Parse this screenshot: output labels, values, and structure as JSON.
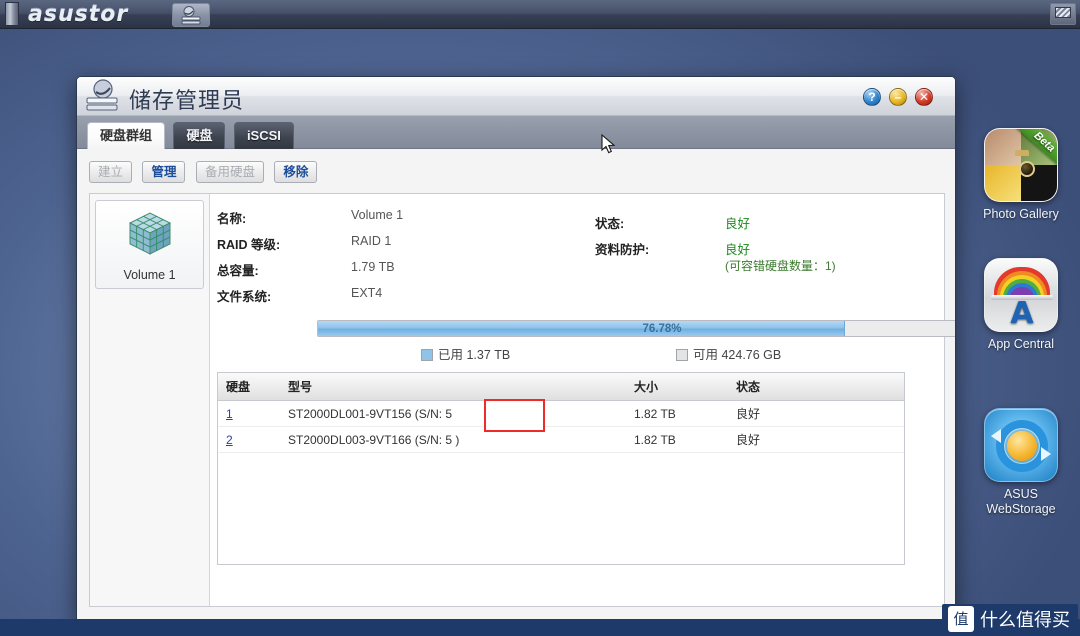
{
  "topbar": {
    "brand": "asustor",
    "storage_tile_icon": "storage-manager-icon",
    "right_icon": "display-icon"
  },
  "desktop": {
    "icons": [
      {
        "label": "Photo Gallery",
        "icon": "photo-gallery-icon",
        "badge": "Beta"
      },
      {
        "label": "App Central",
        "icon": "app-central-icon",
        "badge": ""
      },
      {
        "label": "ASUS WebStorage",
        "label_line1": "ASUS",
        "label_line2": "WebStorage",
        "icon": "asus-webstorage-icon",
        "badge": ""
      }
    ]
  },
  "window": {
    "title": "储存管理员",
    "icon": "storage-manager-icon",
    "controls": {
      "help": "?",
      "minimize": "–",
      "close": "✕"
    },
    "tabs": [
      {
        "label": "硬盘群组",
        "active": true
      },
      {
        "label": "硬盘",
        "active": false
      },
      {
        "label": "iSCSI",
        "active": false
      }
    ],
    "toolbar": [
      {
        "label": "建立",
        "enabled": false
      },
      {
        "label": "管理",
        "enabled": true
      },
      {
        "label": "备用硬盘",
        "enabled": false
      },
      {
        "label": "移除",
        "enabled": true
      }
    ],
    "volume_list": [
      {
        "label": "Volume 1",
        "icon": "volume-cube-icon"
      }
    ],
    "details": {
      "name_label": "名称:",
      "name_value": "Volume 1",
      "raid_label": "RAID 等级:",
      "raid_value": "RAID 1",
      "capacity_label": "总容量:",
      "capacity_value": "1.79 TB",
      "filesystem_label": "文件系统:",
      "filesystem_value": "EXT4",
      "status_label": "状态:",
      "status_value": "良好",
      "protection_label": "资料防护:",
      "protection_value": "良好",
      "protection_note": "(可容错硬盘数量：1)"
    },
    "usage": {
      "percent_label": "76.78%",
      "percent_value": 76.78,
      "used_label": "已用 1.37 TB",
      "free_label": "可用 424.76 GB"
    },
    "disk_table": {
      "headers": [
        "硬盘",
        "型号",
        "大小",
        "状态"
      ],
      "rows": [
        {
          "index": "1",
          "model": "ST2000DL001-9VT156 (S/N: 5",
          "size": "1.82 TB",
          "state": "良好"
        },
        {
          "index": "2",
          "model": "ST2000DL003-9VT166 (S/N: 5                  )",
          "size": "1.82 TB",
          "state": "良好"
        }
      ],
      "redaction": "redaction-box"
    }
  },
  "watermark": {
    "logo": "值",
    "text": "什么值得买"
  },
  "colors": {
    "accent_blue": "#2b3fae",
    "status_green": "#1a8a1a",
    "progress_blue": "#8ec3ea",
    "redaction_red": "#ee2b2b",
    "watermark_bg": "#1d3a6b"
  }
}
